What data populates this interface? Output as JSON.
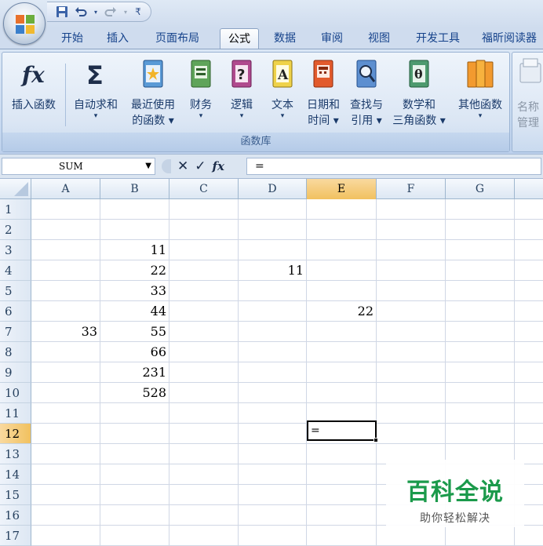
{
  "quick_access": {
    "icons": [
      "save-icon",
      "undo-icon",
      "redo-icon",
      "customize-icon"
    ]
  },
  "tabs": [
    "开始",
    "插入",
    "页面布局",
    "公式",
    "数据",
    "审阅",
    "视图",
    "开发工具",
    "福昕阅读器"
  ],
  "active_tab": "公式",
  "ribbon": {
    "group_label": "函数库",
    "buttons": [
      {
        "line1": "插入函数",
        "line2": "",
        "icon": "fx-icon"
      },
      {
        "line1": "自动求和",
        "line2": "▾",
        "icon": "sigma-icon"
      },
      {
        "line1": "最近使用",
        "line2": "的函数 ▾",
        "icon": "book-star-icon"
      },
      {
        "line1": "财务",
        "line2": "▾",
        "icon": "book-finance-icon"
      },
      {
        "line1": "逻辑",
        "line2": "▾",
        "icon": "book-question-icon"
      },
      {
        "line1": "文本",
        "line2": "▾",
        "icon": "book-text-icon"
      },
      {
        "line1": "日期和",
        "line2": "时间 ▾",
        "icon": "book-calendar-icon"
      },
      {
        "line1": "查找与",
        "line2": "引用 ▾",
        "icon": "book-search-icon"
      },
      {
        "line1": "数学和",
        "line2": "三角函数 ▾",
        "icon": "book-theta-icon"
      },
      {
        "line1": "其他函数",
        "line2": "▾",
        "icon": "books-more-icon"
      }
    ],
    "name_group": {
      "line1": "名称",
      "line2": "管理"
    }
  },
  "formula_bar": {
    "name_box": "SUM",
    "formula": "="
  },
  "columns": [
    "A",
    "B",
    "C",
    "D",
    "E",
    "F",
    "G"
  ],
  "selected_column": "E",
  "rows": [
    "1",
    "2",
    "3",
    "4",
    "5",
    "6",
    "7",
    "8",
    "9",
    "10",
    "11",
    "12",
    "13",
    "14",
    "15",
    "16",
    "17"
  ],
  "selected_row": "12",
  "cells": {
    "B3": "11",
    "B4": "22",
    "B5": "33",
    "B6": "44",
    "B7": "55",
    "B8": "66",
    "B9": "231",
    "B10": "528",
    "D4": "11",
    "E6": "22",
    "A7": "33"
  },
  "active_cell": {
    "ref": "E12",
    "value": "="
  },
  "watermark": {
    "title": "百科全说",
    "subtitle": "助你轻松解决"
  }
}
